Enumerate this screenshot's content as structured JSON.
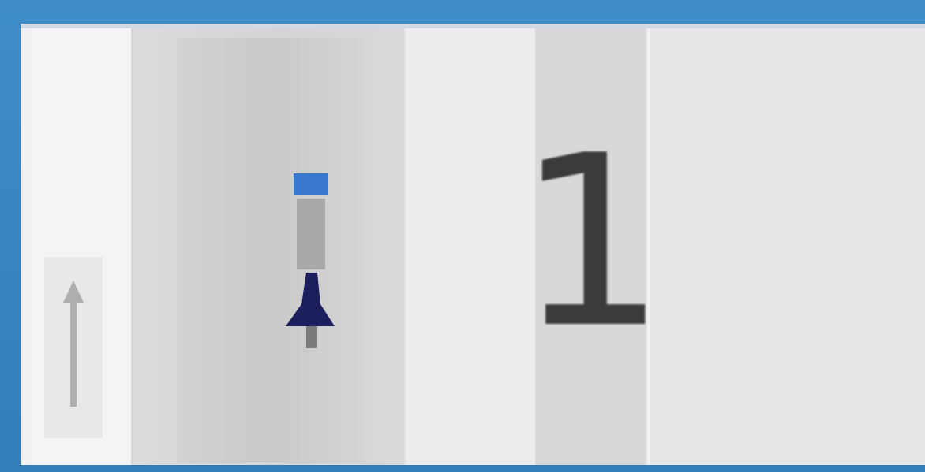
{
  "window": {
    "frame_color": "#3a86bf"
  },
  "cells": [
    {
      "icon": "arrow-up-icon"
    },
    {
      "icon": "pin-icon",
      "accent": "#3a78d0",
      "ink": "#1c1f5c"
    },
    {
      "value": "1"
    }
  ]
}
